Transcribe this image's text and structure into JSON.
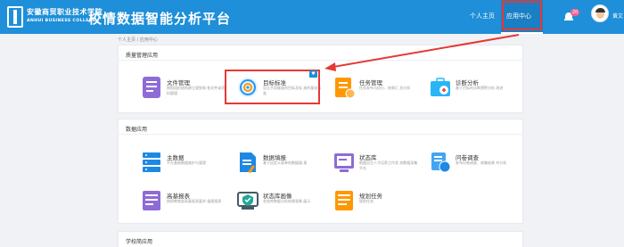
{
  "header": {
    "school_name_cn": "安徽商贸职业技术学院",
    "school_name_en": "ANHUI BUSINESS COLLEGE",
    "app_title": "校情数据智能分析平台",
    "nav": {
      "personal_home": "个人主页",
      "app_center": "应用中心"
    },
    "notification_count": "20",
    "username": "黄文"
  },
  "breadcrumb": "个人主页 / 应用中心",
  "sections": [
    {
      "title": "质量管理应用",
      "apps": [
        {
          "name": "文件管理",
          "desc": "按照组织结构建立规划和 各文件或资料管理",
          "icon": "document-list-icon",
          "color": "#8e6bd6"
        },
        {
          "name": "目标标准",
          "desc": "设立不同维度的目标及标 准的量化标准",
          "icon": "target-icon",
          "color": "#2196f3",
          "badge": "♥"
        },
        {
          "name": "任务管理",
          "desc": "任务发布与执行、结果汇 总分析",
          "icon": "task-clipboard-icon",
          "color": "#ff9800"
        },
        {
          "name": "诊断分析",
          "desc": "基于目标的诊断预警分析 改进",
          "icon": "medical-kit-icon",
          "color": "#29b6f6"
        }
      ]
    },
    {
      "title": "数据应用",
      "apps": [
        {
          "name": "主数据",
          "desc": "平台基础数据维护与管理",
          "icon": "database-icon",
          "color": "#1e88e5"
        },
        {
          "name": "数据填报",
          "desc": "基于自定义表单的数据填 报",
          "icon": "form-edit-icon",
          "color": "#1e88e5"
        },
        {
          "name": "状态库",
          "desc": "根据自主人才培养工作状 态数据采集平台",
          "icon": "status-library-icon",
          "color": "#8e6bd6"
        },
        {
          "name": "问卷调查",
          "desc": "发布问卷调查、收集结果 并分析",
          "icon": "survey-icon",
          "color": "#42a5f5"
        },
        {
          "name": "高基报表",
          "desc": "按照教育部高基报表要求 填报报表",
          "icon": "report-icon",
          "color": "#8e6bd6"
        },
        {
          "name": "状态库画像",
          "desc": "状态库数据分析结果画像 展示",
          "icon": "profile-shield-icon",
          "color": "#26a69a"
        },
        {
          "name": "规划任务",
          "desc": "规划任务",
          "icon": "planning-icon",
          "color": "#ff9800"
        }
      ]
    },
    {
      "title": "学校简应用"
    }
  ],
  "colors": {
    "brand": "#1e8fd8",
    "highlight": "#e53935"
  }
}
